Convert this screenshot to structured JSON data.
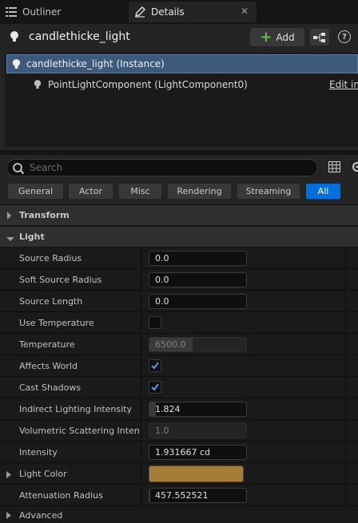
{
  "tabs": {
    "outliner": "Outliner",
    "details": "Details",
    "close_glyph": "✕"
  },
  "actor": {
    "name": "candlethicke_light",
    "add_label": "Add",
    "help_glyph": "?"
  },
  "components": [
    {
      "label": "candlethicke_light (Instance)",
      "selected": true
    },
    {
      "label": "PointLightComponent (LightComponent0)",
      "link": "Edit in"
    }
  ],
  "search": {
    "placeholder": "Search"
  },
  "filters": [
    {
      "label": "General",
      "active": false
    },
    {
      "label": "Actor",
      "active": false
    },
    {
      "label": "Misc",
      "active": false
    },
    {
      "label": "Rendering",
      "active": false
    },
    {
      "label": "Streaming",
      "active": false
    },
    {
      "label": "All",
      "active": true
    }
  ],
  "categories": {
    "transform": "Transform",
    "light": "Light",
    "advanced": "Advanced"
  },
  "properties": [
    {
      "label": "Source Radius",
      "type": "number",
      "value": "0.0"
    },
    {
      "label": "Soft Source Radius",
      "type": "number",
      "value": "0.0"
    },
    {
      "label": "Source Length",
      "type": "number",
      "value": "0.0"
    },
    {
      "label": "Use Temperature",
      "type": "checkbox",
      "checked": false
    },
    {
      "label": "Temperature",
      "type": "slider",
      "value": "6500.0",
      "disabled": true,
      "fill": 0.45
    },
    {
      "label": "Affects World",
      "type": "checkbox",
      "checked": true
    },
    {
      "label": "Cast Shadows",
      "type": "checkbox",
      "checked": true
    },
    {
      "label": "Indirect Lighting Intensity",
      "type": "slider",
      "value": "1.824",
      "disabled": false,
      "fill": 0.07
    },
    {
      "label": "Volumetric Scattering Inten...",
      "type": "slider",
      "value": "1.0",
      "disabled": true,
      "fill": 0.0
    },
    {
      "label": "Intensity",
      "type": "number",
      "value": "1.931667 cd"
    },
    {
      "label": "Light Color",
      "type": "color",
      "color": "#a77c37"
    },
    {
      "label": "Attenuation Radius",
      "type": "slider",
      "value": "457.552521",
      "disabled": false,
      "fill": 0.01
    }
  ],
  "colors": {
    "accent": "#0070e0",
    "selection": "#3d5a7a",
    "check": "#4a9cf0",
    "add_plus": "#5ec24a"
  }
}
